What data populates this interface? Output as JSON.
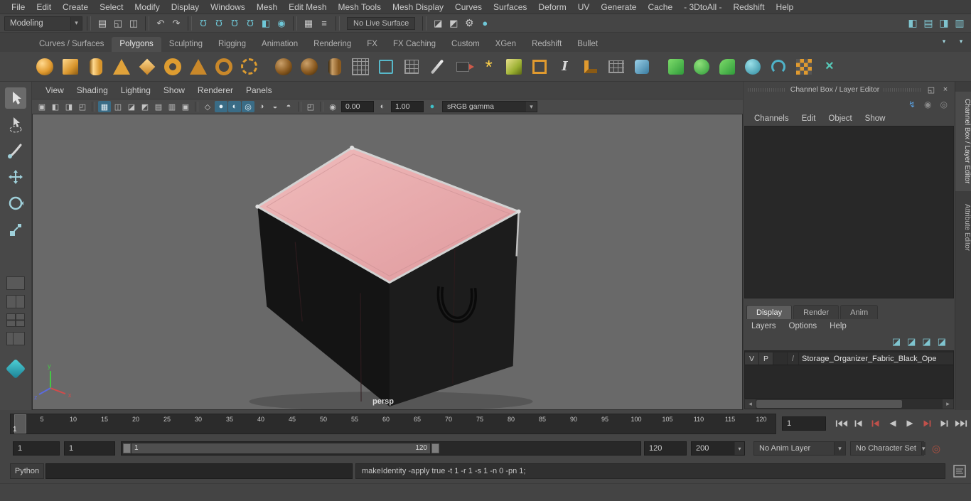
{
  "colors": {
    "accent_blue": "#3a6c86",
    "viewport_bg": "#696969",
    "panel_bg": "#444444",
    "field_bg": "#262626",
    "lid_pink": "#e8a6a6",
    "box_black": "#141414",
    "trim_silver": "#d6d6d6",
    "key_red": "#c0504a",
    "shelf_orange": "#dd9c30",
    "shelf_green": "#3fae4a",
    "shelf_teal": "#4fb3c9"
  },
  "icons": {
    "arrow_down": "▾",
    "arrow_up": "▴",
    "new_scene": "▤",
    "open_scene": "◱",
    "save_scene": "◫",
    "undo": "↶",
    "redo": "↷",
    "magnet": "Ω",
    "snap_plane": "◧",
    "live_ring": "◉",
    "history": "▦",
    "inputs": "≡",
    "render_frame": "◪",
    "ipr_render": "◩",
    "render_settings": "⚙",
    "hypershade_dot": "●",
    "panel_toggle_a": "◧",
    "panel_toggle_b": "▤",
    "panel_toggle_c": "◨",
    "panel_toggle_d": "▥",
    "popout": "◱",
    "close": "×",
    "lightning": "↯",
    "circle": "◎",
    "dot_circle": "◉",
    "multiply": "×",
    "beam": "I",
    "asterisk": "*",
    "slash": "/",
    "scroll_left": "◂",
    "scroll_right": "▸",
    "image_plane": "▣",
    "bookmarks": "◧",
    "camera_attrs": "◨",
    "pan_zoom": "◰",
    "grid_toggle": "▦",
    "film_gate": "◫",
    "res_gate": "◪",
    "gate_mask": "◩",
    "field_chart": "▤",
    "safe_action": "▥",
    "safe_title": "▣",
    "wireframe": "◇",
    "smooth_shade": "●",
    "textured": "◐",
    "all_lights": "◎",
    "shadows": "◑",
    "ssao": "◒",
    "motion_blur": "◓",
    "isolate_select": "◰",
    "exposure_icon": "◉",
    "contrast_icon": "◐",
    "gamma_dot": "●",
    "layer_btn": "◪"
  },
  "menu_bar": {
    "items": [
      "File",
      "Edit",
      "Create",
      "Select",
      "Modify",
      "Display",
      "Windows",
      "Mesh",
      "Edit Mesh",
      "Mesh Tools",
      "Mesh Display",
      "Curves",
      "Surfaces",
      "Deform",
      "UV",
      "Generate",
      "Cache",
      "- 3DtoAll -",
      "Redshift",
      "Help"
    ]
  },
  "status_line": {
    "menu_set": "Modeling",
    "live_surface": "No Live Surface"
  },
  "shelf": {
    "tabs": [
      {
        "label": "Curves / Surfaces"
      },
      {
        "label": "Polygons",
        "active": true
      },
      {
        "label": "Sculpting"
      },
      {
        "label": "Rigging"
      },
      {
        "label": "Animation"
      },
      {
        "label": "Rendering"
      },
      {
        "label": "FX"
      },
      {
        "label": "FX Caching"
      },
      {
        "label": "Custom"
      },
      {
        "label": "XGen"
      },
      {
        "label": "Redshift"
      },
      {
        "label": "Bullet"
      }
    ]
  },
  "panel_menu": {
    "items": [
      "View",
      "Shading",
      "Lighting",
      "Show",
      "Renderer",
      "Panels"
    ]
  },
  "viewport_toolbar": {
    "exposure": "0.00",
    "gamma": "1.00",
    "view_transform": "sRGB gamma"
  },
  "viewport": {
    "camera_label": "persp",
    "axis_x": "x",
    "axis_y": "y",
    "axis_z": "z"
  },
  "channel_box": {
    "title": "Channel Box / Layer Editor",
    "menu_items": [
      "Channels",
      "Edit",
      "Object",
      "Show"
    ],
    "side_tabs": [
      {
        "label": "Channel Box / Layer Editor",
        "active": true
      },
      {
        "label": "Attribute Editor"
      }
    ]
  },
  "layer_editor": {
    "tabs": [
      {
        "label": "Display",
        "active": true
      },
      {
        "label": "Render"
      },
      {
        "label": "Anim"
      }
    ],
    "menu_items": [
      "Layers",
      "Options",
      "Help"
    ],
    "layer": {
      "visibility": "V",
      "playback": "P",
      "name": "Storage_Organizer_Fabric_Black_Ope"
    }
  },
  "timeline": {
    "ticks": [
      "5",
      "10",
      "15",
      "20",
      "25",
      "30",
      "35",
      "40",
      "45",
      "50",
      "55",
      "60",
      "65",
      "70",
      "75",
      "80",
      "85",
      "90",
      "95",
      "100",
      "105",
      "110",
      "115",
      "120"
    ],
    "current_frame": "1",
    "current_frame_field": "1"
  },
  "range_slider": {
    "playback_start": "1",
    "anim_start": "1",
    "handle_start_label": "1",
    "handle_end_label": "120",
    "playback_end": "120",
    "anim_end": "200",
    "anim_layer": "No Anim Layer",
    "character_set": "No Character Set"
  },
  "command_line": {
    "language": "Python",
    "input": "",
    "result": "makeIdentity -apply true -t 1 -r 1 -s 1 -n 0 -pn 1;"
  }
}
